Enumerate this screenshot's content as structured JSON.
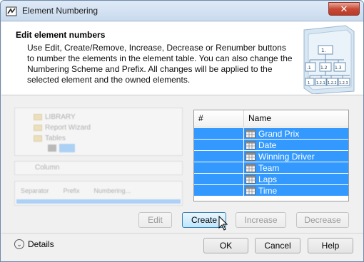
{
  "window": {
    "title": "Element Numbering",
    "close_glyph": "✕"
  },
  "header": {
    "title": "Edit element numbers",
    "description": "Use Edit, Create/Remove, Increase, Decrease or Renumber buttons to number the elements in the element table. You can also change the Numbering Scheme and Prefix. All changes will be applied to the selected element and the owned elements.",
    "graphic_labels": [
      "1.",
      ".1",
      "1.2",
      "1.3",
      "1",
      "1.2.1",
      "1.2.2",
      "1.2.3"
    ]
  },
  "left_panel": {
    "tree_items": [
      "LIBRARY",
      "Report Wizard",
      "Tables"
    ],
    "combo_value": "Column",
    "grid_headers": [
      "Separator",
      "Prefix",
      "Numbering..."
    ]
  },
  "table": {
    "columns": [
      "#",
      "Name"
    ],
    "rows": [
      {
        "number": "",
        "name": "Grand Prix"
      },
      {
        "number": "",
        "name": "Date"
      },
      {
        "number": "",
        "name": "Winning Driver"
      },
      {
        "number": "",
        "name": "Team"
      },
      {
        "number": "",
        "name": "Laps"
      },
      {
        "number": "",
        "name": "Time"
      }
    ],
    "selection_color": "#3399ff"
  },
  "actions": {
    "edit": "Edit",
    "create": "Create",
    "increase": "Increase",
    "decrease": "Decrease"
  },
  "footer": {
    "details": "Details",
    "ok": "OK",
    "cancel": "Cancel",
    "help": "Help"
  }
}
